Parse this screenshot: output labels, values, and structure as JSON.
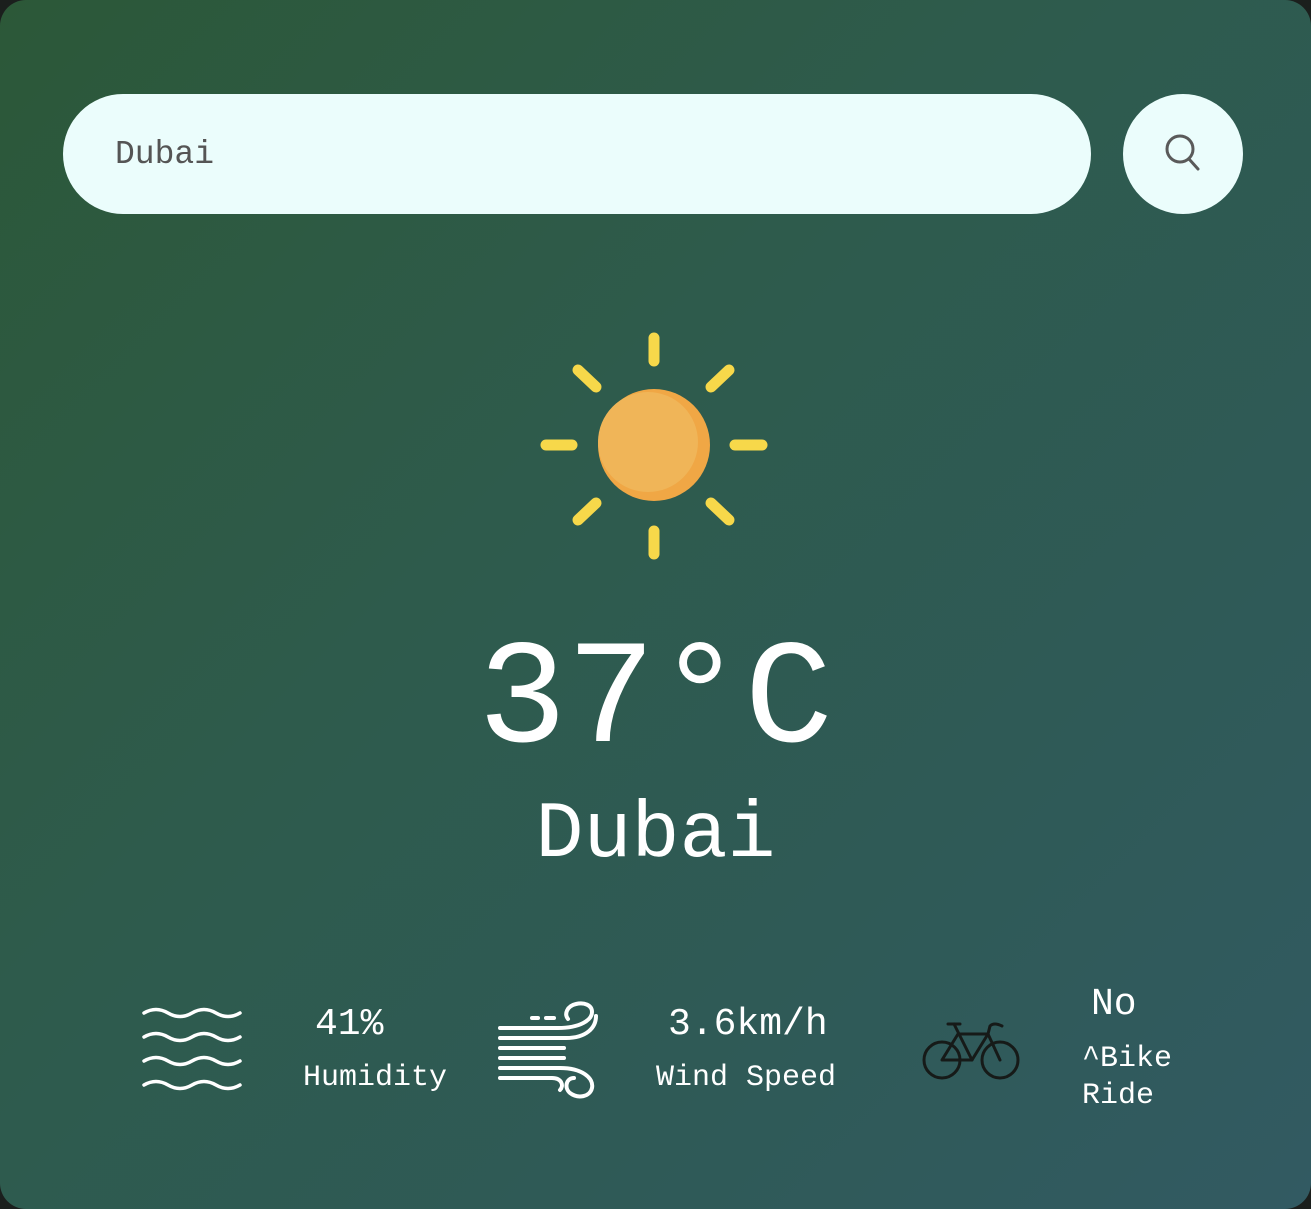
{
  "search": {
    "value": "Dubai",
    "icon": "search-icon"
  },
  "weather": {
    "icon": "sun-icon",
    "temperature": "37°C",
    "city": "Dubai"
  },
  "details": {
    "humidity": {
      "icon": "humidity-icon",
      "value": "41%",
      "label": "Humidity"
    },
    "wind": {
      "icon": "wind-icon",
      "value": "3.6km/h",
      "label": "Wind Speed"
    },
    "bike": {
      "icon": "bicycle-icon",
      "value": "No",
      "label_line1": "^Bike",
      "label_line2": "Ride"
    }
  },
  "colors": {
    "card_gradient_start": "#2c5838",
    "card_gradient_end": "#325a62",
    "search_background": "#ebfdfc",
    "sun_core": "#f0b558",
    "sun_rays": "#f7d84a"
  }
}
